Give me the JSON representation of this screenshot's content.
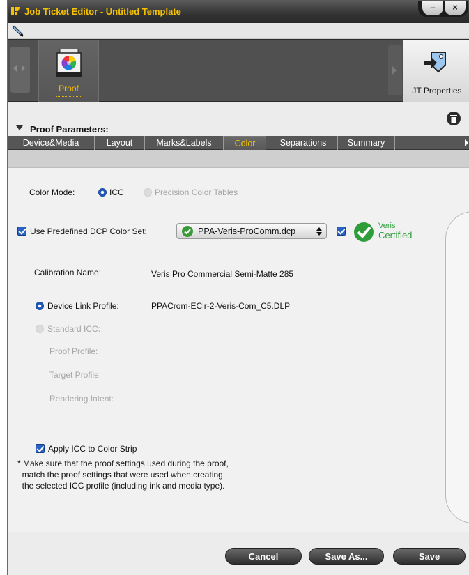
{
  "window": {
    "title": "Job Ticket Editor - Untitled Template"
  },
  "toolbar": {
    "proof_label": "Proof",
    "jt_properties_label": "JT Properties"
  },
  "section": {
    "title": "Proof Parameters:"
  },
  "tabs": [
    {
      "label": "Device&Media",
      "active": false
    },
    {
      "label": "Layout",
      "active": false
    },
    {
      "label": "Marks&Labels",
      "active": false
    },
    {
      "label": "Color",
      "active": true
    },
    {
      "label": "Separations",
      "active": false
    },
    {
      "label": "Summary",
      "active": false
    }
  ],
  "color": {
    "mode_label": "Color Mode:",
    "mode_icc": "ICC",
    "mode_pct": "Precision Color Tables",
    "use_dcp_label": "Use Predefined DCP Color Set:",
    "dcp_value": "PPA-Veris-ProComm.dcp",
    "veris_line1": "Veris",
    "veris_line2": "Certified",
    "calibration_label": "Calibration Name:",
    "calibration_value": "Veris Pro Commercial Semi-Matte 285",
    "device_link_label": "Device Link Profile:",
    "device_link_value": "PPACrom-EClr-2-Veris-Com_C5.DLP",
    "standard_icc_label": "Standard ICC:",
    "proof_profile_label": "Proof Profile:",
    "target_profile_label": "Target Profile:",
    "rendering_intent_label": "Rendering Intent:",
    "apply_icc_label": "Apply ICC to Color Strip",
    "note": "* Make sure that the proof settings used during the proof,\n  match the proof settings that were used when creating\n  the selected ICC profile (including ink and media type)."
  },
  "footer": {
    "cancel": "Cancel",
    "save_as": "Save As...",
    "save": "Save"
  },
  "colors": {
    "accent": "#f5c200",
    "check_blue": "#2a63c1",
    "veris_green": "#2f9d3a"
  }
}
